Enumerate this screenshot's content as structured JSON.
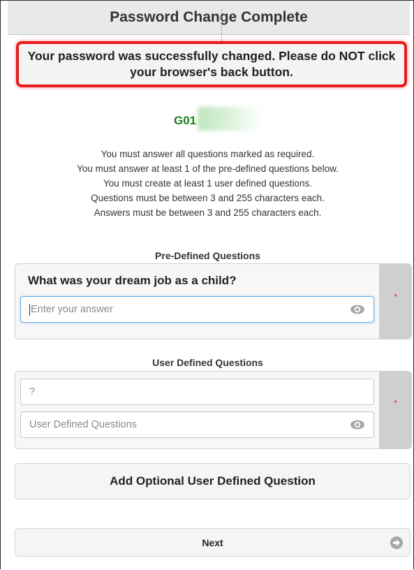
{
  "header": {
    "title": "Password Change Complete"
  },
  "alert": {
    "message": "Your password was successfully changed. Please do NOT click your browser's back button."
  },
  "user": {
    "id_partial": "G01"
  },
  "rules": [
    "You must answer all questions marked as required.",
    "You must answer at least 1 of the pre-defined questions below.",
    "You must create at least 1 user defined questions.",
    "Questions must be between 3 and 255 characters each.",
    "Answers must be between 3 and 255 characters each."
  ],
  "predefined": {
    "section_title": "Pre-Defined Questions",
    "question": "What was your dream job as a child?",
    "answer_placeholder": "Enter your answer",
    "required_marker": "*"
  },
  "userdefined": {
    "section_title": "User Defined Questions",
    "question_value": "?",
    "answer_placeholder": "User Defined Questions",
    "required_marker": "*"
  },
  "buttons": {
    "add_optional": "Add Optional User Defined Question",
    "next": "Next"
  },
  "colors": {
    "alert_border": "#e81b1b",
    "user_id": "#1b7f1b",
    "required": "#e03030",
    "focus_border": "#66afe9"
  }
}
